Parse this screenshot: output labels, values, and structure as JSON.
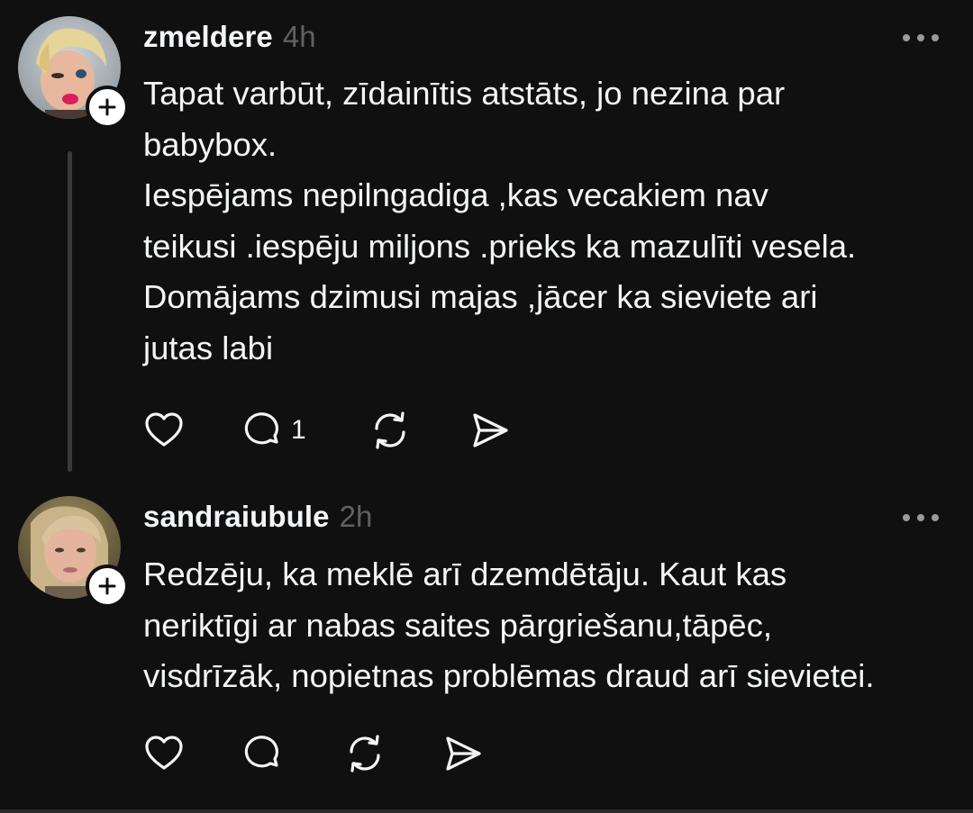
{
  "posts": [
    {
      "username": "zmeldere",
      "time": "4h",
      "lines": [
        "Tapat varbūt, zīdainītis atstāts, jo nezina par",
        "babybox.",
        "Iespējams nepilngadiga ,kas vecakiem nav",
        "teikusi .iespēju miljons .prieks ka mazulīti vesela.",
        "Domājams dzimusi majas ,jācer ka sieviete ari",
        "jutas labi"
      ],
      "reply_count": "1"
    },
    {
      "username": "sandraiubule",
      "time": "2h",
      "lines": [
        "Redzēju, ka meklē arī dzemdētāju. Kaut kas",
        "neriktīgi ar nabas saites pārgriešanu,tāpēc,",
        "visdrīzāk, nopietnas problēmas draud arī sievietei."
      ],
      "reply_count": ""
    }
  ],
  "icons": {
    "like": "heart-icon",
    "reply": "comment-icon",
    "repost": "repost-icon",
    "share": "send-icon",
    "more": "more-options-icon",
    "follow": "plus-icon"
  },
  "colors": {
    "background": "#101010",
    "text": "#f3f5f7",
    "secondary": "#616161"
  }
}
